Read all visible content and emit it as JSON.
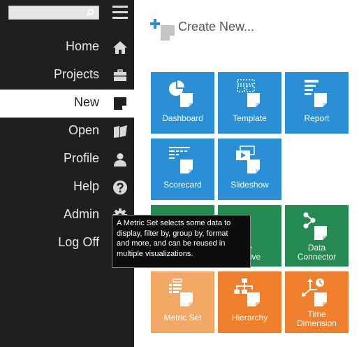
{
  "sidebar": {
    "search": {
      "placeholder": "",
      "icon": "magnifier-icon"
    },
    "menu_icon": "hamburger-icon",
    "items": [
      {
        "label": "Home",
        "icon": "home-icon",
        "active": false
      },
      {
        "label": "Projects",
        "icon": "briefcase-icon",
        "active": false
      },
      {
        "label": "New",
        "icon": "new-document-icon",
        "active": true
      },
      {
        "label": "Open",
        "icon": "open-folder-icon",
        "active": false
      },
      {
        "label": "Profile",
        "icon": "person-icon",
        "active": false
      },
      {
        "label": "Help",
        "icon": "help-icon",
        "active": false
      },
      {
        "label": "Admin",
        "icon": "gear-icon",
        "active": false
      },
      {
        "label": "Log Off",
        "icon": "",
        "active": false
      }
    ]
  },
  "main": {
    "header": {
      "label": "Create New...",
      "icon": "create-new-icon"
    },
    "tiles": [
      {
        "label": "Dashboard",
        "color": "#2b8fd6",
        "icon": "dashboard-icon"
      },
      {
        "label": "Template",
        "color": "#2b8fd6",
        "icon": "template-icon"
      },
      {
        "label": "Report",
        "color": "#2b8fd6",
        "icon": "report-icon"
      },
      {
        "label": "Scorecard",
        "color": "#2b8fd6",
        "icon": "scorecard-icon"
      },
      {
        "label": "Slideshow",
        "color": "#2b8fd6",
        "icon": "slideshow-icon"
      },
      {
        "label": "Data",
        "label2": "Connector",
        "color": "#258a52",
        "icon": "data-connector-icon"
      },
      {
        "label": "Metric Set",
        "color": "#f3a865",
        "icon": "metric-set-icon"
      },
      {
        "label": "Hierarchy",
        "color": "#ef7f2c",
        "icon": "hierarchy-icon"
      },
      {
        "label": "Time",
        "label2": "Dimension",
        "color": "#ef7f2c",
        "icon": "time-dimension-icon"
      }
    ],
    "hidden_tile": {
      "label_fragment_1": "e",
      "label_fragment_2": "ective"
    }
  },
  "tooltip": {
    "lines": [
      "A Metric Set selects some data to",
      "display, filter by, group by, format",
      "and more, and can be reused in",
      "multiple visualizations."
    ]
  }
}
